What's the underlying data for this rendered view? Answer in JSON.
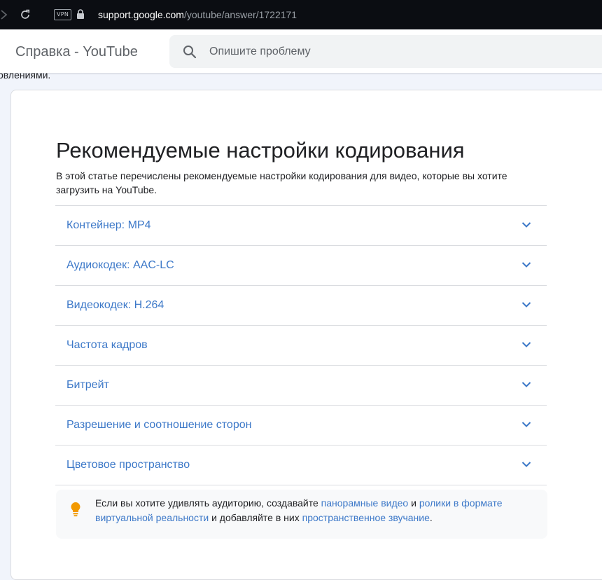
{
  "browser": {
    "vpn_label": "VPN",
    "url_host": "support.google.com",
    "url_path": "/youtube/answer/1722171"
  },
  "header": {
    "product_title": "Справка - YouTube",
    "search_placeholder": "Опишите проблему"
  },
  "notice": {
    "clipped_text": "овлениями."
  },
  "article": {
    "title": "Рекомендуемые настройки кодирования",
    "intro": "В этой статье перечислены рекомендуемые настройки кодирования для видео, которые вы хотите загрузить на YouTube.",
    "sections": [
      {
        "label": "Контейнер: MP4"
      },
      {
        "label": "Аудиокодек: AAC-LC"
      },
      {
        "label": "Видеокодек: H.264"
      },
      {
        "label": "Частота кадров"
      },
      {
        "label": "Битрейт"
      },
      {
        "label": "Разрешение и соотношение сторон"
      },
      {
        "label": "Цветовое пространство"
      }
    ]
  },
  "tip": {
    "text_1": "Если вы хотите удивлять аудиторию, создавайте ",
    "link_1": "панорамные видео",
    "text_2": " и ",
    "link_2": "ролики в формате виртуальной реальности",
    "text_3": " и добавляйте в них ",
    "link_3": "пространственное звучание",
    "text_4": "."
  },
  "icons": {
    "forward": "chevron-right-icon",
    "reload": "reload-icon",
    "lock": "lock-icon",
    "search": "search-icon",
    "expand": "chevron-down-icon",
    "tip": "lightbulb-icon"
  },
  "colors": {
    "link_blue": "#3c78c8",
    "tip_bulb": "#f29900",
    "chrome_bg": "#0b0d12"
  }
}
